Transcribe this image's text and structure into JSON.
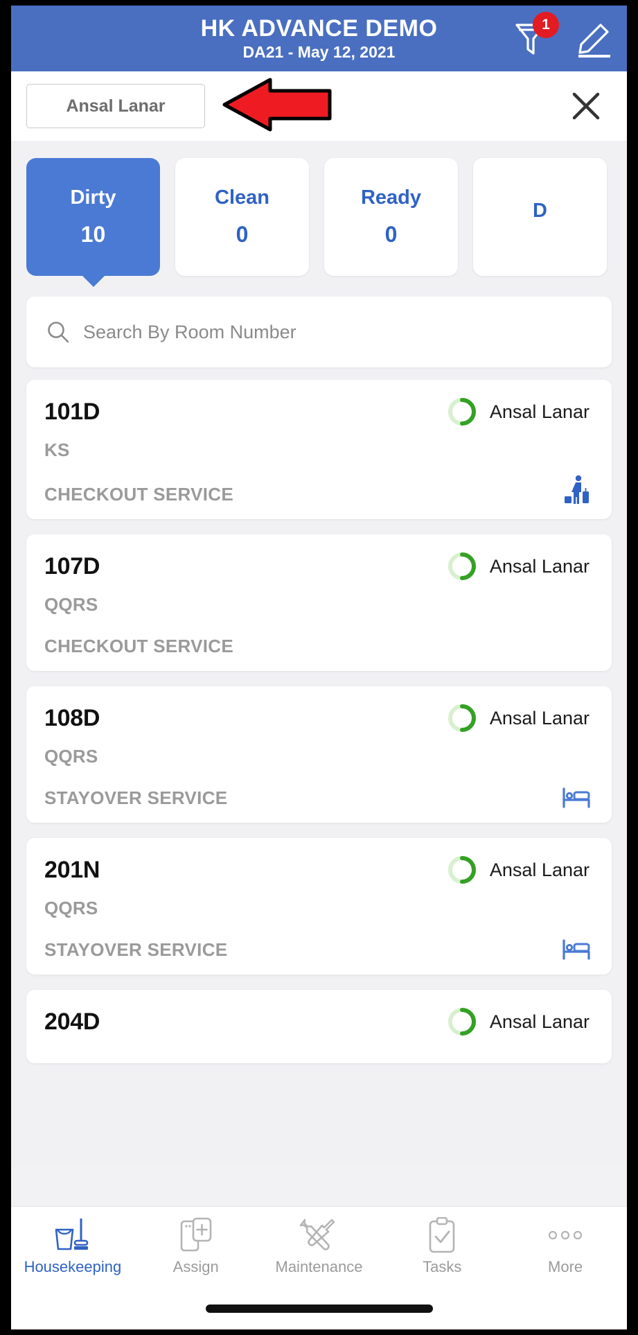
{
  "header": {
    "title": "HK ADVANCE DEMO",
    "subtitle": "DA21 - May 12, 2021",
    "filter_icon": "filter-funnel-icon",
    "filter_badge": "1",
    "edit_icon": "pencil-edit-icon",
    "background_color": "#4a6fc0"
  },
  "filter_chip": {
    "label": "Ansal Lanar",
    "close_icon": "close-x-icon"
  },
  "annotation": {
    "type": "red-left-arrow",
    "color": "#ee1c22"
  },
  "status_tabs": [
    {
      "label": "Dirty",
      "count": "10",
      "active": true
    },
    {
      "label": "Clean",
      "count": "0",
      "active": false
    },
    {
      "label": "Ready",
      "count": "0",
      "active": false
    },
    {
      "label": "D",
      "count": "",
      "active": false
    }
  ],
  "search": {
    "placeholder": "Search By Room Number",
    "value": "",
    "icon": "search-icon"
  },
  "rooms": [
    {
      "number": "101D",
      "room_type": "KS",
      "service": "CHECKOUT SERVICE",
      "assignee": "Ansal  Lanar",
      "progress_icon": "progress-ring-icon",
      "service_icon": "luggage-traveler-icon"
    },
    {
      "number": "107D",
      "room_type": "QQRS",
      "service": "CHECKOUT SERVICE",
      "assignee": "Ansal  Lanar",
      "progress_icon": "progress-ring-icon",
      "service_icon": "none"
    },
    {
      "number": "108D",
      "room_type": "QQRS",
      "service": "STAYOVER SERVICE",
      "assignee": "Ansal  Lanar",
      "progress_icon": "progress-ring-icon",
      "service_icon": "bed-icon"
    },
    {
      "number": "201N",
      "room_type": "QQRS",
      "service": "STAYOVER SERVICE",
      "assignee": "Ansal  Lanar",
      "progress_icon": "progress-ring-icon",
      "service_icon": "bed-icon"
    },
    {
      "number": "204D",
      "room_type": "",
      "service": "",
      "assignee": "Ansal  Lanar",
      "progress_icon": "progress-ring-icon",
      "service_icon": "none"
    }
  ],
  "bottom_nav": [
    {
      "label": "Housekeeping",
      "icon": "bucket-mop-icon",
      "active": true
    },
    {
      "label": "Assign",
      "icon": "assign-card-plus-icon",
      "active": false
    },
    {
      "label": "Maintenance",
      "icon": "hammer-wrench-icon",
      "active": false
    },
    {
      "label": "Tasks",
      "icon": "clipboard-check-icon",
      "active": false
    },
    {
      "label": "More",
      "icon": "three-dots-icon",
      "active": false
    }
  ],
  "colors": {
    "brand_blue": "#4a6fc0",
    "tab_active_blue": "#4a7ad4",
    "accent_text_blue": "#2f62c4",
    "badge_red": "#e31b23",
    "progress_green": "#34a125",
    "progress_track_green": "#d8f0cf",
    "muted_gray": "#9a9a9a"
  }
}
